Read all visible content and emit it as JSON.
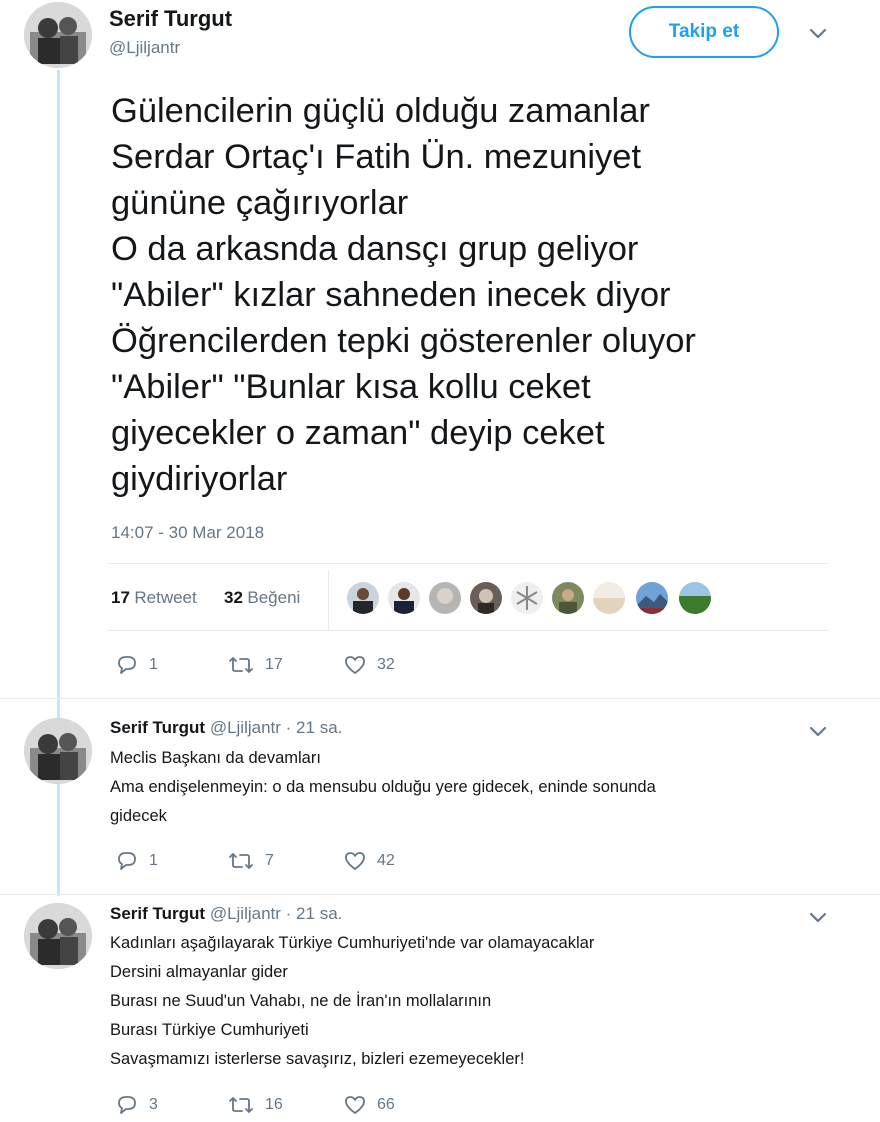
{
  "main_tweet": {
    "author_name": "Serif Turgut",
    "author_handle": "@Ljiljantr",
    "follow_label": "Takip et",
    "lines": [
      "Gülencilerin güçlü olduğu zamanlar",
      "Serdar Ortaç'ı Fatih Ün. mezuniyet",
      "gününe çağırıyorlar",
      "O da arkasnda dansçı grup geliyor",
      "\"Abiler\" kızlar sahneden inecek diyor",
      "Öğrencilerden tepki gösterenler oluyor",
      "\"Abiler\" \"Bunlar kısa kollu ceket",
      "giyecekler o zaman\" deyip ceket",
      "giydiriyorlar"
    ],
    "timestamp": "14:07 - 30 Mar 2018",
    "retweet_count": "17",
    "retweet_label": "Retweet",
    "like_count": "32",
    "like_label": "Beğeni",
    "actions": {
      "replies": "1",
      "retweets": "17",
      "likes": "32"
    }
  },
  "replies": [
    {
      "author_name": "Serif Turgut",
      "author_handle": "@Ljiljantr",
      "time": "· 21 sa.",
      "lines": [
        "Meclis Başkanı da devamları",
        "Ama endişelenmeyin: o da mensubu olduğu yere gidecek, eninde sonunda",
        "gidecek"
      ],
      "actions": {
        "replies": "1",
        "retweets": "7",
        "likes": "42"
      }
    },
    {
      "author_name": "Serif Turgut",
      "author_handle": "@Ljiljantr",
      "time": "· 21 sa.",
      "lines": [
        "Kadınları aşağılayarak Türkiye Cumhuriyeti'nde var olamayacaklar",
        "Dersini almayanlar gider",
        "Burası ne Suud'un Vahabı, ne de İran'ın mollalarının",
        "Burası Türkiye Cumhuriyeti",
        "Savaşmamızı isterlerse savaşırız, bizleri ezemeyecekler!"
      ],
      "actions": {
        "replies": "3",
        "retweets": "16",
        "likes": "66"
      }
    }
  ],
  "colors": {
    "accent": "#1da1f2",
    "thread_line": "#c4e6fa",
    "muted_text": "#657786",
    "divider": "#e6ecf0"
  },
  "icons": [
    "reply-icon",
    "retweet-icon",
    "like-icon",
    "chevron-down-icon"
  ]
}
